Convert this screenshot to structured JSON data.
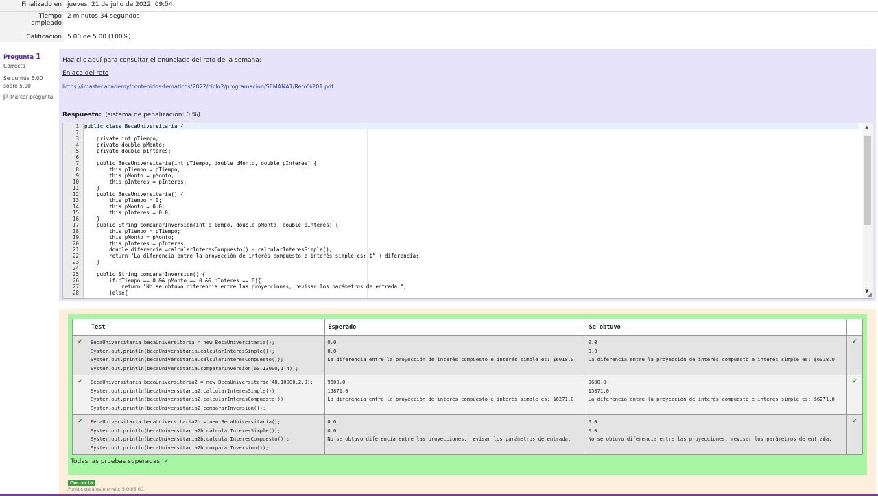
{
  "summary": {
    "finished_label": "Finalizado en",
    "finished_value": "jueves, 21 de julio de 2022, 09:54",
    "time_label_1": "Tiempo",
    "time_label_2": "empleado",
    "time_value": "2 minutos 34 segundos",
    "grade_label": "Calificación",
    "grade_value": "5.00 de 5.00 (100%)"
  },
  "question": {
    "label": "Pregunta",
    "number": "1",
    "state": "Correcta",
    "score_line1": "Se puntúa 5.00",
    "score_line2": "sobre 5.00",
    "flag_label": "Marcar pregunta",
    "intro_text": "Haz clic aquí para consultar el enunciado del reto de la semana:",
    "link_text": "Enlace del reto",
    "url_text": "https://imaster.academy/contenidos-tematicos/2022/ciclo2/programacion/SEMANA1/Reto%201.pdf",
    "answer_label": "Respuesta:",
    "answer_penalty": "(sistema de penalización: 0 %)"
  },
  "editor": {
    "line_numbers": [
      "1",
      "2",
      "3",
      "4",
      "5",
      "6",
      "7",
      "8",
      "9",
      "10",
      "11",
      "12",
      "13",
      "14",
      "15",
      "16",
      "17",
      "18",
      "19",
      "20",
      "21",
      "22",
      "23",
      "24",
      "25",
      "26",
      "27",
      "28"
    ],
    "code_lines": [
      "public class BecaUniversitaria {",
      "",
      "    private int pTiempo;",
      "    private double pMonto;",
      "    private double pInteres;",
      "",
      "    public BecaUniversitaria(int pTiempo, double pMonto, double pInteres) {",
      "        this.pTiempo = pTiempo;",
      "        this.pMonto = pMonto;",
      "        this.pInteres = pInteres;",
      "    }",
      "    public BecaUniversitaria() {",
      "        this.pTiempo = 0;",
      "        this.pMonto = 0.0;",
      "        this.pInteres = 0.0;",
      "    }",
      "    public String compararInversion(int pTiempo, double pMonto, double pInteres) {",
      "        this.pTiempo = pTiempo;",
      "        this.pMonto = pMonto;",
      "        this.pInteres = pInteres;",
      "        double diferencia =calcularInteresCompuesto() - calcularInteresSimple();",
      "        return \"La diferencia entre la proyección de interés compuesto e interés simple es: $\" + diferencia;",
      "    }",
      "",
      "    public String compararInversion() {",
      "        if(pTiempo == 0 && pMonto == 0 && pInteres == 0){",
      "            return \"No se obtuvo diferencia entre las proyecciones, revisar los parámetros de entrada.\";",
      "        }else{"
    ]
  },
  "results": {
    "headers": {
      "test": "Test",
      "expected": "Esperado",
      "got": "Se obtuvo"
    },
    "rows": [
      {
        "test": [
          "BecaUniversitaria becaUniversitaria = new BecaUniversitaria();",
          "System.out.println(becaUniversitaria.calcularInteresSimple());",
          "System.out.println(becaUniversitaria.calcularInteresCompuesto());",
          "System.out.println(becaUniversitaria.compararInversion(60,13000,1.4));"
        ],
        "expected": [
          "0.0",
          "0.0",
          "La diferencia entre la proyección de interés compuesto e interés simple es: $6018.0"
        ],
        "got": [
          "0.0",
          "0.0",
          "La diferencia entre la proyección de interés compuesto e interés simple es: $6018.0"
        ]
      },
      {
        "test": [
          "BecaUniversitaria becaUniversitaria2 = new BecaUniversitaria(48,10000,2.0);",
          "System.out.println(becaUniversitaria2.calcularInteresSimple());",
          "System.out.println(becaUniversitaria2.calcularInteresCompuesto());",
          "System.out.println(becaUniversitaria2.compararInversion());"
        ],
        "expected": [
          "9600.0",
          "15871.0",
          "La diferencia entre la proyección de interés compuesto e interés simple es: $6271.0"
        ],
        "got": [
          "9600.0",
          "15871.0",
          "La diferencia entre la proyección de interés compuesto e interés simple es: $6271.0"
        ]
      },
      {
        "test": [
          "BecaUniversitaria becaUniversitaria2b = new BecaUniversitaria();",
          "System.out.println(becaUniversitaria2b.calcularInteresSimple());",
          "System.out.println(becaUniversitaria2b.calcularInteresCompuesto());",
          "System.out.println(becaUniversitaria2b.compararInversion());"
        ],
        "expected": [
          "0.0",
          "0.0",
          "No se obtuvo diferencia entre las proyecciones, revisar los parámetros de entrada."
        ],
        "got": [
          "0.0",
          "0.0",
          "No se obtuvo diferencia entre las proyecciones, revisar los parámetros de entrada."
        ]
      }
    ],
    "all_passed": "Todas las pruebas superadas.",
    "badge": "Correcta",
    "points": "Puntos para este envío: 5.00/5.00."
  },
  "icons": {
    "pass": "check-icon",
    "flag": "flag-icon"
  },
  "colors": {
    "question_bg": "#e7e3fb",
    "results_bg": "#fcefdc",
    "pass_bg": "#a6f5a2",
    "check": "#2a8a2a",
    "accent": "#5a2aa8"
  }
}
